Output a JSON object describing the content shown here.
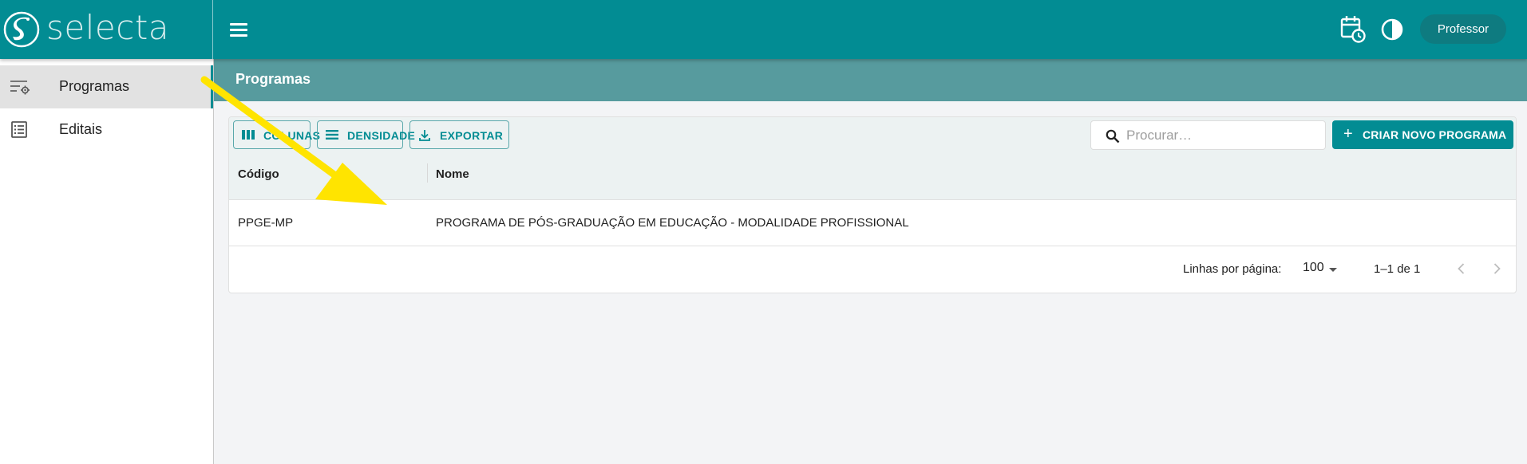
{
  "app": {
    "brand": "selecta",
    "user_label": "Professor"
  },
  "sidebar": {
    "items": [
      {
        "label": "Programas",
        "icon": "list-settings-icon",
        "active": true
      },
      {
        "label": "Editais",
        "icon": "list-alt-icon",
        "active": false
      }
    ]
  },
  "page": {
    "title": "Programas"
  },
  "toolbar": {
    "columns_label": "COLUNAS",
    "density_label": "DENSIDADE",
    "export_label": "EXPORTAR",
    "search_placeholder": "Procurar…",
    "create_label": "CRIAR NOVO PROGRAMA"
  },
  "table": {
    "columns": [
      "Código",
      "Nome"
    ],
    "rows": [
      [
        "PPGE-MP",
        "PROGRAMA DE PÓS-GRADUAÇÃO EM EDUCAÇÃO - MODALIDADE PROFISSIONAL"
      ]
    ]
  },
  "pagination": {
    "rows_per_page_label": "Linhas por página:",
    "rows_per_page": "100",
    "range": "1–1 de 1"
  },
  "colors": {
    "primary": "#028c93",
    "header_band": "#579b9e",
    "annotation_arrow": "#ffe400"
  }
}
